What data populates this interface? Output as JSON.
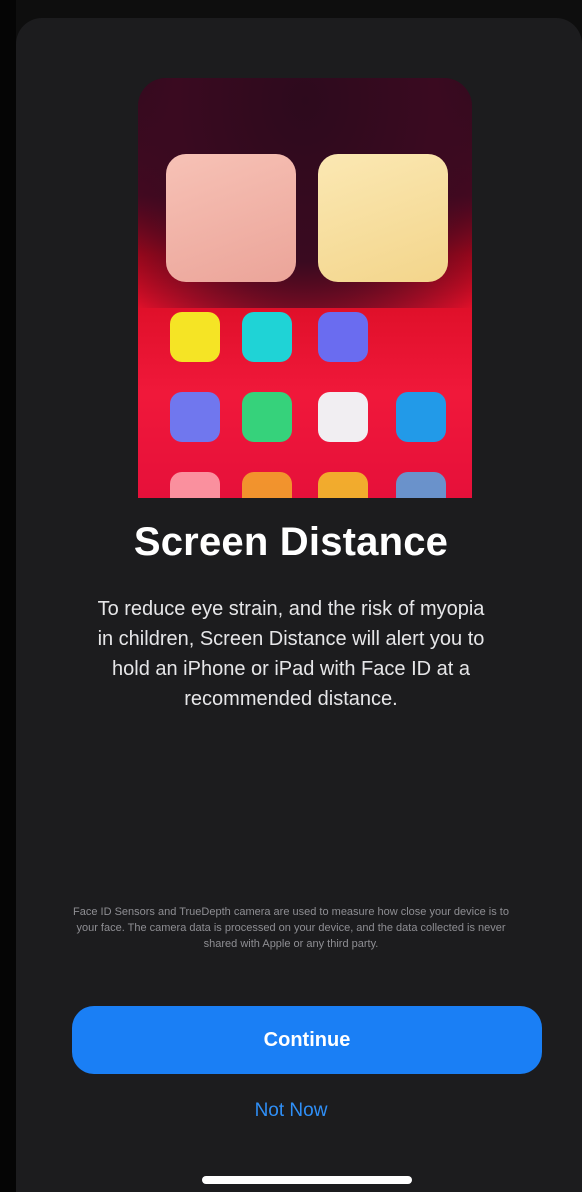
{
  "onboarding": {
    "title": "Screen Distance",
    "body": "To reduce eye strain, and the risk of myopia in children, Screen Distance will alert you to hold an iPhone or iPad with Face ID at a recommended distance.",
    "fine_print": "Face ID Sensors and TrueDepth camera are used to measure how close your device is to your face. The camera data is processed on your device, and the data collected is never shared with Apple or any third party.",
    "continue_label": "Continue",
    "not_now_label": "Not Now"
  },
  "illustration": {
    "widgets": [
      "pink-widget",
      "yellow-widget"
    ],
    "app_icon_colors": [
      "#f5e425",
      "#1fd3d6",
      "#6a6cf0",
      "#7077ee",
      "#36d27b",
      "#f1eef2",
      "#229ae8"
    ]
  },
  "colors": {
    "accent": "#1a7ff5",
    "link": "#2f8ff7",
    "sheet_background": "#1c1c1e"
  }
}
